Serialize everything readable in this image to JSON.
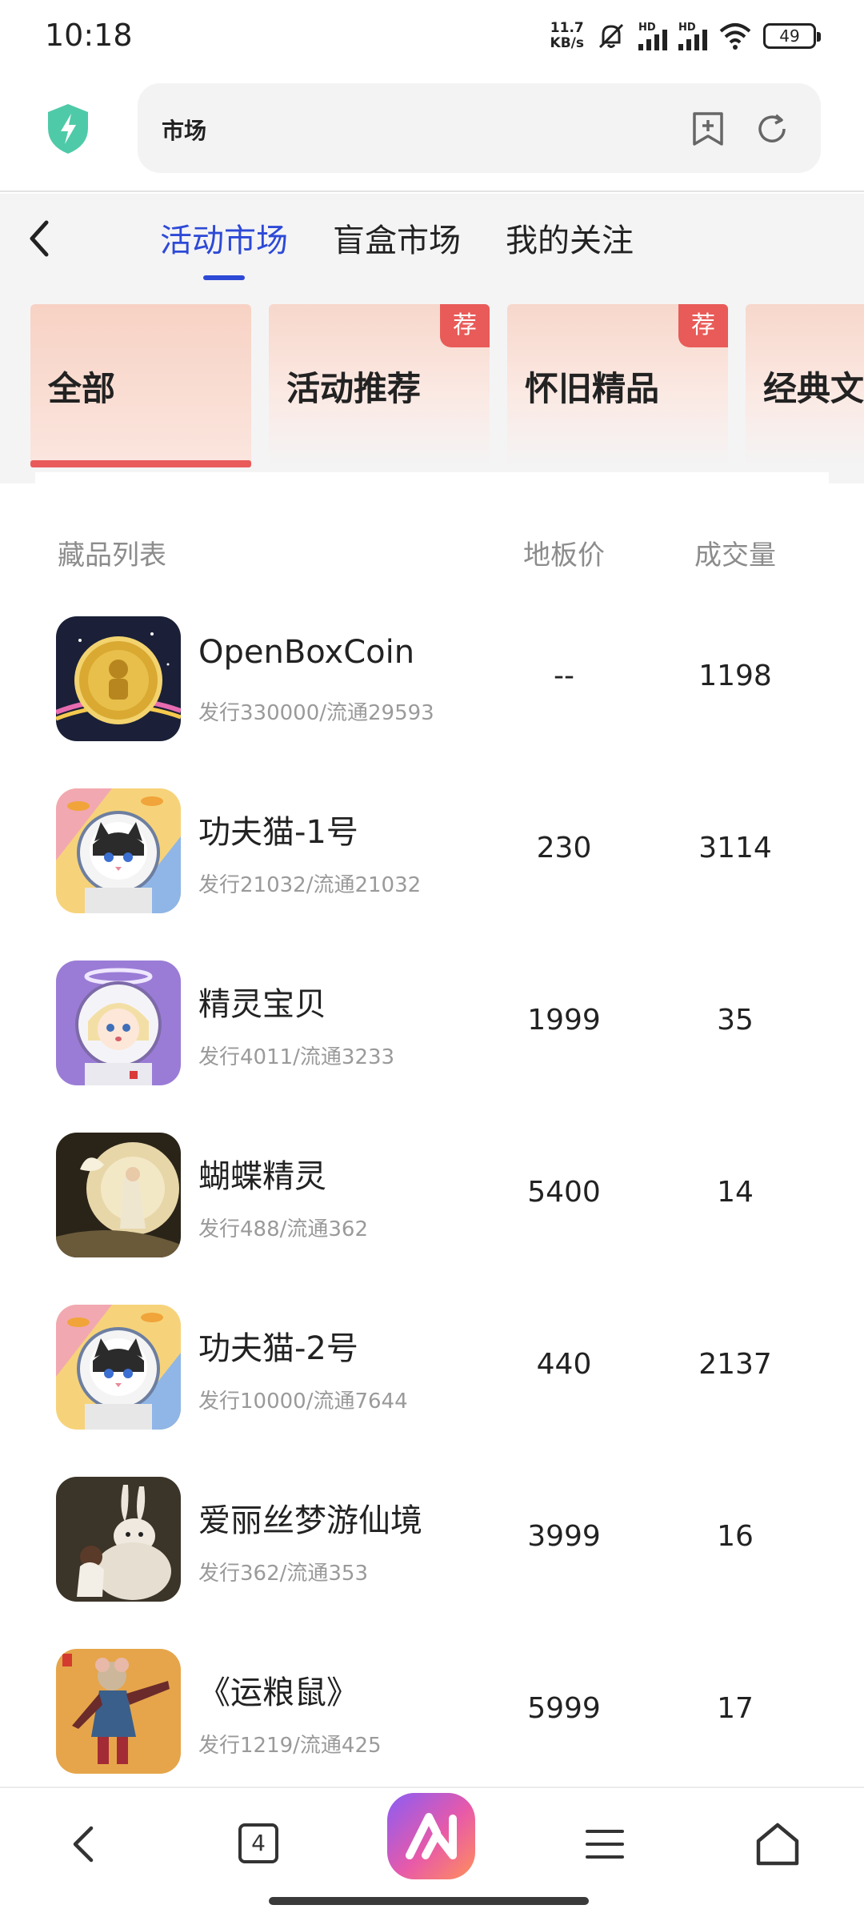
{
  "status_bar": {
    "time": "10:18",
    "net_speed_value": "11.7",
    "net_speed_unit": "KB/s",
    "hd1": "HD",
    "hd2": "HD",
    "battery": "49"
  },
  "browser": {
    "address": "市场"
  },
  "tabs": [
    {
      "label": "活动市场",
      "active": true
    },
    {
      "label": "盲盒市场",
      "active": false
    },
    {
      "label": "我的关注",
      "active": false
    }
  ],
  "categories": [
    {
      "label": "全部",
      "badge": ""
    },
    {
      "label": "活动推荐",
      "badge": "荐"
    },
    {
      "label": "怀旧精品",
      "badge": "荐"
    },
    {
      "label": "经典文",
      "badge": ""
    }
  ],
  "list_header": {
    "name": "藏品列表",
    "price": "地板价",
    "volume": "成交量"
  },
  "items": [
    {
      "name": "OpenBoxCoin",
      "sub": "发行330000/流通29593",
      "price": "--",
      "volume": "1198",
      "thumb": "coin"
    },
    {
      "name": "功夫猫-1号",
      "sub": "发行21032/流通21032",
      "price": "230",
      "volume": "3114",
      "thumb": "cat"
    },
    {
      "name": "精灵宝贝",
      "sub": "发行4011/流通3233",
      "price": "1999",
      "volume": "35",
      "thumb": "girl"
    },
    {
      "name": "蝴蝶精灵",
      "sub": "发行488/流通362",
      "price": "5400",
      "volume": "14",
      "thumb": "butterfly"
    },
    {
      "name": "功夫猫-2号",
      "sub": "发行10000/流通7644",
      "price": "440",
      "volume": "2137",
      "thumb": "cat"
    },
    {
      "name": "爱丽丝梦游仙境",
      "sub": "发行362/流通353",
      "price": "3999",
      "volume": "16",
      "thumb": "rabbit"
    },
    {
      "name": "《运粮鼠》",
      "sub": "发行1219/流通425",
      "price": "5999",
      "volume": "17",
      "thumb": "mouse"
    }
  ],
  "bottom_nav": {
    "tab_count": "4"
  },
  "colors": {
    "accent_blue": "#2d49d6",
    "accent_red": "#e85b58",
    "shield_teal": "#4fcaa8"
  }
}
